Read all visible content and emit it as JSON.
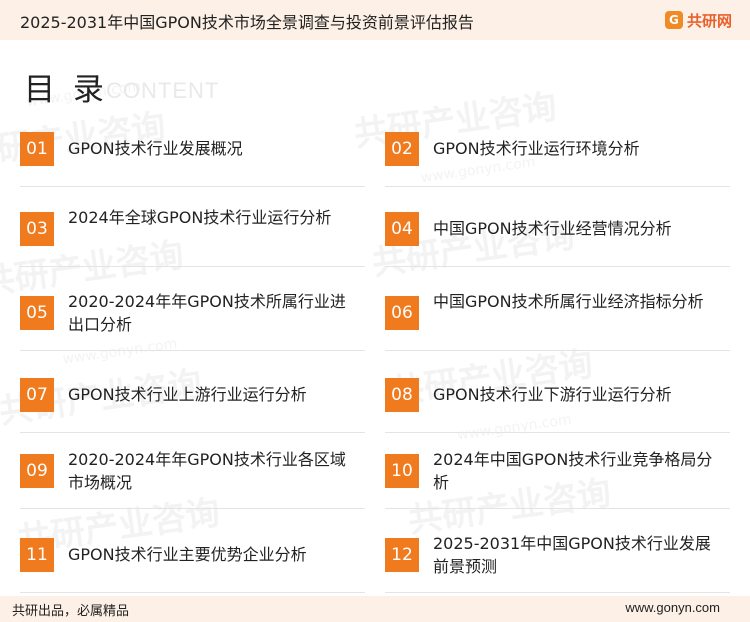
{
  "header": {
    "title": "2025-2031年中国GPON技术市场全景调查与投资前景评估报告",
    "brand_icon": "G",
    "brand_name": "共研网",
    "background": "#fdf0e6"
  },
  "watermark": {
    "text_cn": "共研产业咨询",
    "text_en": "www.gonyn.com"
  },
  "toc": {
    "heading": "目 录",
    "heading_en": "CONTENT",
    "accent": "#f07a1e",
    "items": [
      {
        "num": "01",
        "label": "GPON技术行业发展概况"
      },
      {
        "num": "02",
        "label": "GPON技术行业运行环境分析"
      },
      {
        "num": "03",
        "label": "2024年全球GPON技术行业运行分析"
      },
      {
        "num": "04",
        "label": "中国GPON技术行业经营情况分析"
      },
      {
        "num": "05",
        "label": "2020-2024年年GPON技术所属行业进出口分析"
      },
      {
        "num": "06",
        "label": "中国GPON技术所属行业经济指标分析"
      },
      {
        "num": "07",
        "label": "GPON技术行业上游行业运行分析"
      },
      {
        "num": "08",
        "label": "GPON技术行业下游行业运行分析"
      },
      {
        "num": "09",
        "label": "2020-2024年年GPON技术行业各区域市场概况"
      },
      {
        "num": "10",
        "label": "2024年中国GPON技术行业竞争格局分析"
      },
      {
        "num": "11",
        "label": "GPON技术行业主要优势企业分析"
      },
      {
        "num": "12",
        "label": "2025-2031年中国GPON技术行业发展前景预测"
      }
    ]
  },
  "footer": {
    "slogan": "共研出品，必属精品",
    "url": "www.gonyn.com"
  }
}
